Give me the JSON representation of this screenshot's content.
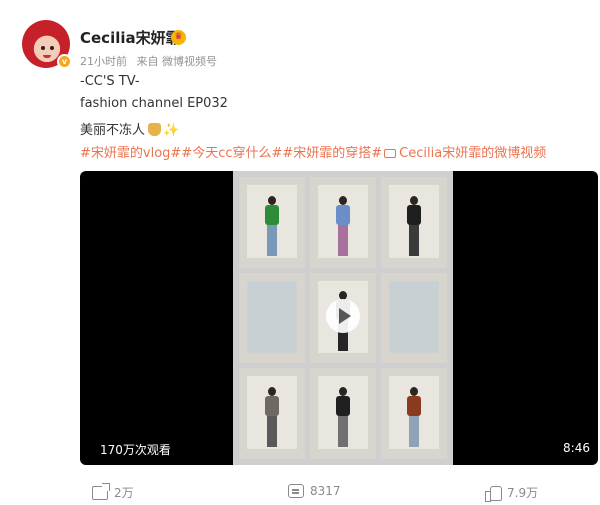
{
  "post": {
    "author": "Cecilia宋妍霏",
    "verified_badge": "v",
    "time": "21小时前",
    "source": "来自 微博视频号",
    "lines": [
      "-CC'S TV-",
      "fashion channel EP032",
      "美丽不冻人"
    ],
    "hashtags": "#宋妍霏的vlog##今天cc穿什么##宋妍霏的穿搭#",
    "video_link": "Cecilia宋妍霏的微博视频"
  },
  "video": {
    "views": "170万次观看",
    "duration": "8:46"
  },
  "actions": {
    "repost": "2万",
    "comment": "8317",
    "like": "7.9万"
  },
  "icons": [
    "crown-icon",
    "play-icon",
    "repost-icon",
    "comment-icon",
    "like-icon",
    "video-link-icon"
  ],
  "colors": {
    "link": "#eb7350",
    "muted": "#939393",
    "video_bg": "#000000"
  }
}
